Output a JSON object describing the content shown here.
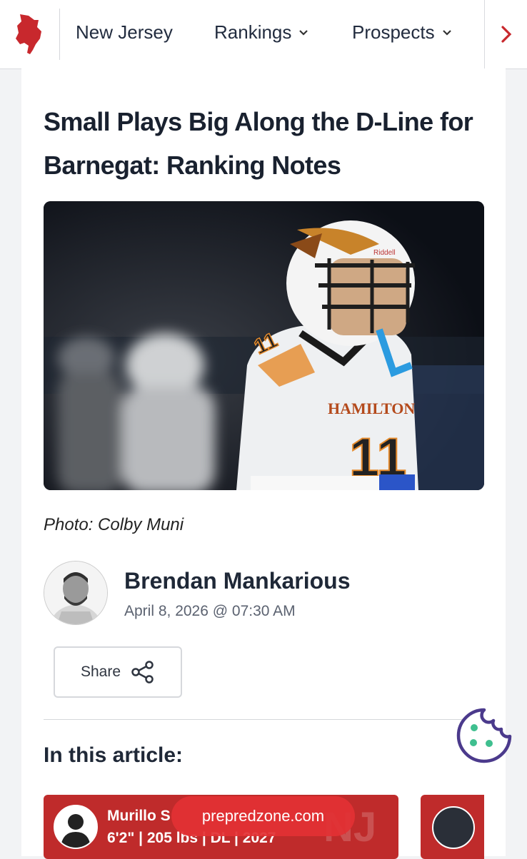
{
  "nav": {
    "items": [
      {
        "label": "New Jersey"
      },
      {
        "label": "Rankings"
      },
      {
        "label": "Prospects"
      }
    ]
  },
  "article": {
    "headline_line1": "Small Plays Big Along the D-Line for",
    "headline_line2": "Barnegat: Ranking Notes",
    "photo_caption": "Photo: Colby Muni",
    "author": "Brendan Mankarious",
    "date": "April 8, 2026 @ 07:30 AM",
    "share_label": "Share",
    "in_article_heading": "In this article:"
  },
  "hero_text": {
    "helmet_brand": "Riddell",
    "jersey_name": "HAMILTON",
    "jersey_number": "11"
  },
  "player_card": {
    "name": "Murillo S",
    "meta": "6'2\" | 205 lbs | DL | 2027",
    "state_watermark": "NJ"
  },
  "browser": {
    "url": "prepredzone.com"
  },
  "colors": {
    "brand_red": "#bf2b2b",
    "nav_text": "#222c3f",
    "cookie_green": "#3fbf8f",
    "cookie_purple": "#4b3a8c"
  },
  "icons": {
    "logo": "new-jersey-state-logo",
    "dropdown": "chevron-down-icon",
    "next": "chevron-right-icon",
    "share": "share-icon",
    "cookie": "cookie-icon"
  }
}
